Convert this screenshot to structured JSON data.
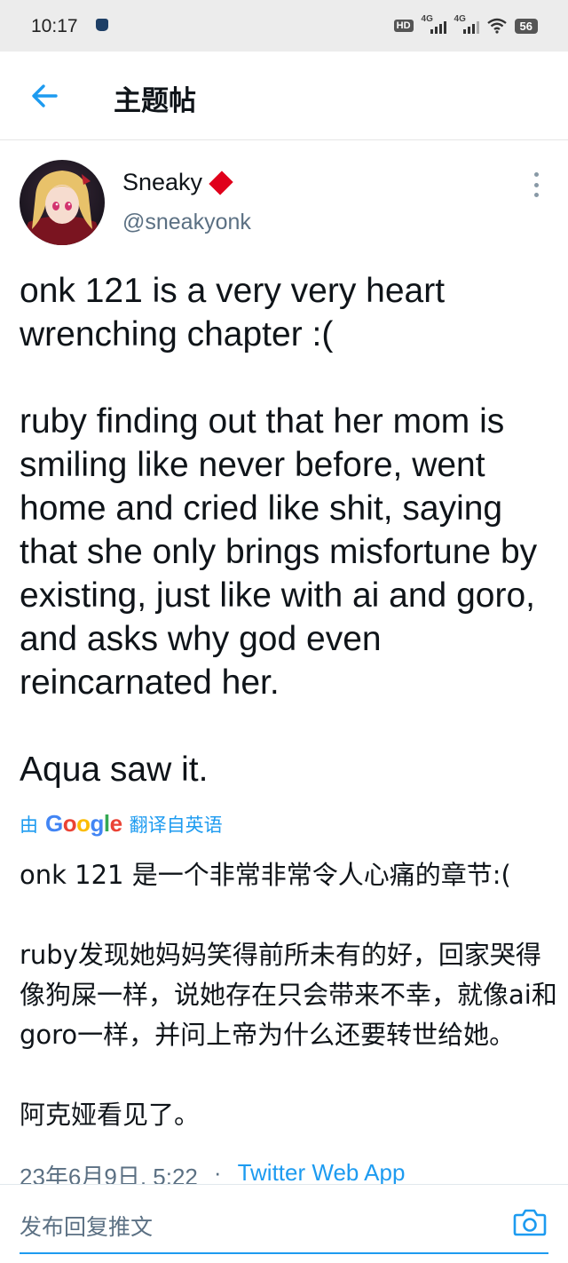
{
  "status_bar": {
    "time": "10:17",
    "hd_badge": "HD",
    "network_1": "4G",
    "network_2": "4G",
    "battery": "56"
  },
  "header": {
    "title": "主题帖"
  },
  "author": {
    "display_name": "Sneaky",
    "handle": "@sneakyonk"
  },
  "tweet": {
    "text": "onk 121 is a very very heart wrenching chapter :(\n\nruby finding out that her mom is smiling like never before, went home and cried like shit, saying that she only brings misfortune by existing, just like with ai and goro, and asks why god even reincarnated her.\n\nAqua saw it.",
    "translated_by_prefix": "由",
    "translated_by_brand": "Google",
    "translated_by_suffix": "翻译自英语",
    "translation": "onk 121 是一个非常非常令人心痛的章节:(\n\nruby发现她妈妈笑得前所未有的好，回家哭得像狗屎一样，说她存在只会带来不幸，就像ai和goro一样，并问上帝为什么还要转世给她。\n\n阿克娅看见了。",
    "date": "23年6月9日, 5:22",
    "separator": "·",
    "source": "Twitter Web App"
  },
  "reply_bar": {
    "placeholder": "发布回复推文"
  },
  "colors": {
    "accent": "#1d9bf0",
    "text": "#0f1419",
    "secondary": "#5b7083",
    "badge": "#e0001b"
  },
  "icons": [
    "back-arrow-icon",
    "diamond-icon",
    "more-options-icon",
    "camera-icon",
    "wifi-icon",
    "signal-icon",
    "battery-icon"
  ]
}
